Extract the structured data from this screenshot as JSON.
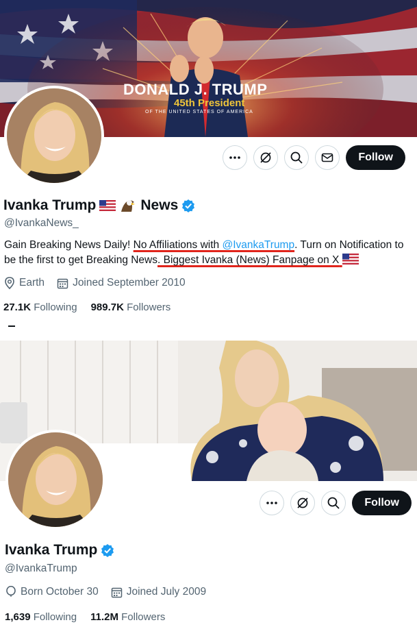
{
  "profile_news": {
    "banner": {
      "title": "DONALD J. TRUMP",
      "subtitle": "45th President",
      "caption": "OF THE UNITED STATES OF AMERICA"
    },
    "actions": {
      "follow_label": "Follow"
    },
    "display_name": "Ivanka Trump",
    "name_suffix": "News",
    "handle": "@IvankaNews_",
    "bio": {
      "part1": "Gain Breaking News Daily! ",
      "part2": "No Affiliations with ",
      "mention": "@IvankaTrump",
      "part3": ". Turn on Notification to be the first to get Breaking News",
      "part4": ". Biggest Ivanka (News) Fanpage on X"
    },
    "location": "Earth",
    "joined": "Joined September 2010",
    "following_count": "27.1K",
    "following_label": "Following",
    "followers_count": "989.7K",
    "followers_label": "Followers"
  },
  "profile_real": {
    "actions": {
      "follow_label": "Follow"
    },
    "display_name": "Ivanka Trump",
    "handle": "@IvankaTrump",
    "born": "Born October 30",
    "joined": "Joined July 2009",
    "following_count": "1,639",
    "following_label": "Following",
    "followers_count": "11.2M",
    "followers_label": "Followers"
  },
  "colors": {
    "accent": "#1d9bf0",
    "underline": "#e0241b",
    "muted": "#536471",
    "dark": "#0f1419"
  },
  "icons": [
    "more-icon",
    "subscribe-icon",
    "search-icon",
    "message-icon",
    "verified-icon",
    "location-icon",
    "calendar-icon",
    "balloon-icon",
    "us-flag-icon",
    "eagle-icon"
  ]
}
